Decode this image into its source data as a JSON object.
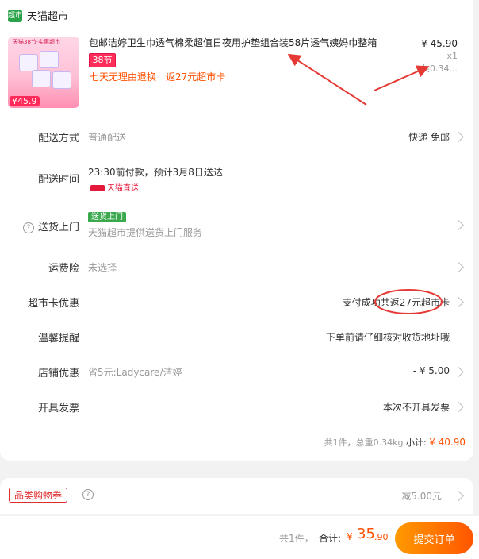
{
  "store": {
    "badge": "超市",
    "name": "天猫超市"
  },
  "product": {
    "title": "包邮洁婷卫生巾透气棉柔超值日夜用护垫组合装58片透气姨妈巾整箱",
    "thumb_tag": "天猫38节·实惠超市",
    "thumb_price": "¥45.9",
    "promo_tag": "38节",
    "benefit_1": "七天无理由退换",
    "benefit_2": "返27元超市卡",
    "price": "¥ 45.90",
    "qty": "x1",
    "total": "共0.34..."
  },
  "rows": {
    "shipping": {
      "label": "配送方式",
      "value": "普通配送",
      "right": "快递 免邮"
    },
    "delivery_time": {
      "label": "配送时间",
      "value": "23:30前付款，预计3月8日送达",
      "tmall_tag": "天猫直送"
    },
    "door": {
      "label": "送货上门",
      "help": "?",
      "tag": "送货上门",
      "value": "天猫超市提供送货上门服务"
    },
    "insurance": {
      "label": "运费险",
      "value": "未选择"
    },
    "card_offer": {
      "label": "超市卡优惠",
      "right": "支付成功共返27元超市卡"
    },
    "reminder": {
      "label": "温馨提醒",
      "right": "下单前请仔细核对收货地址哦"
    },
    "store_offer": {
      "label": "店铺优惠",
      "value": "省5元:Ladycare/洁婷",
      "right": "- ¥ 5.00"
    },
    "invoice": {
      "label": "开具发票",
      "right": "本次不开具发票"
    }
  },
  "summary": {
    "text": "共1件，总重0.34kg",
    "subtotal_label": "小计:",
    "subtotal": "¥ 40.90"
  },
  "coupon": {
    "label": "品类购物券",
    "help": "?",
    "value": "减5.00元"
  },
  "footer": {
    "count": "共1件，",
    "total_label": "合计:",
    "currency": "¥",
    "total_int": "35",
    "total_dec": ".90",
    "submit": "提交订单"
  },
  "colors": {
    "accent": "#ff5000",
    "brand_green": "#2aa34a",
    "annotation_red": "#e53935"
  }
}
